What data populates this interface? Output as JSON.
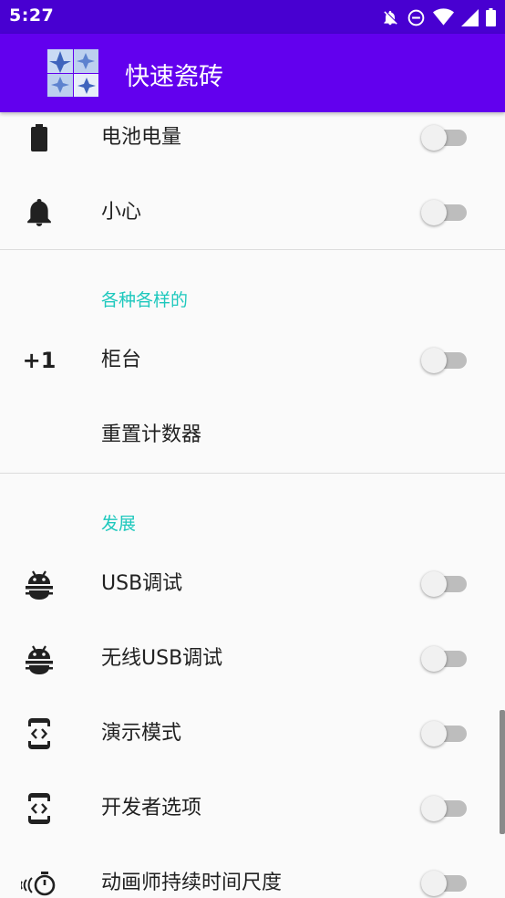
{
  "status_bar": {
    "time": "5:27",
    "icons": [
      "notifications-off-icon",
      "do-not-disturb-icon",
      "wifi-icon",
      "cell-signal-icon",
      "battery-icon"
    ]
  },
  "app_bar": {
    "title": "快速瓷砖",
    "logo": "tile-logo-icon"
  },
  "sections": [
    {
      "items": [
        {
          "icon": "battery-icon",
          "title": "电池电量",
          "switch_on": false
        },
        {
          "icon": "bell-icon",
          "title": "小心",
          "switch_on": false
        }
      ]
    },
    {
      "header": "各种各样的",
      "items": [
        {
          "icon_text": "+1",
          "icon": "plus-one-icon",
          "title": "柜台",
          "switch_on": false
        },
        {
          "title": "重置计数器"
        }
      ]
    },
    {
      "header": "发展",
      "items": [
        {
          "icon": "android-icon",
          "title": "USB调试",
          "switch_on": false
        },
        {
          "icon": "android-icon",
          "title": "无线USB调试",
          "switch_on": false
        },
        {
          "icon": "developer-mode-icon",
          "title": "演示模式",
          "switch_on": false
        },
        {
          "icon": "developer-mode-icon",
          "title": "开发者选项",
          "switch_on": false
        },
        {
          "icon": "animation-timer-icon",
          "title": "动画师持续时间尺度",
          "switch_on": false
        }
      ]
    }
  ],
  "colors": {
    "status_bar": "#4800d1",
    "app_bar": "#6200ee",
    "category_accent": "#1ec8bd"
  }
}
